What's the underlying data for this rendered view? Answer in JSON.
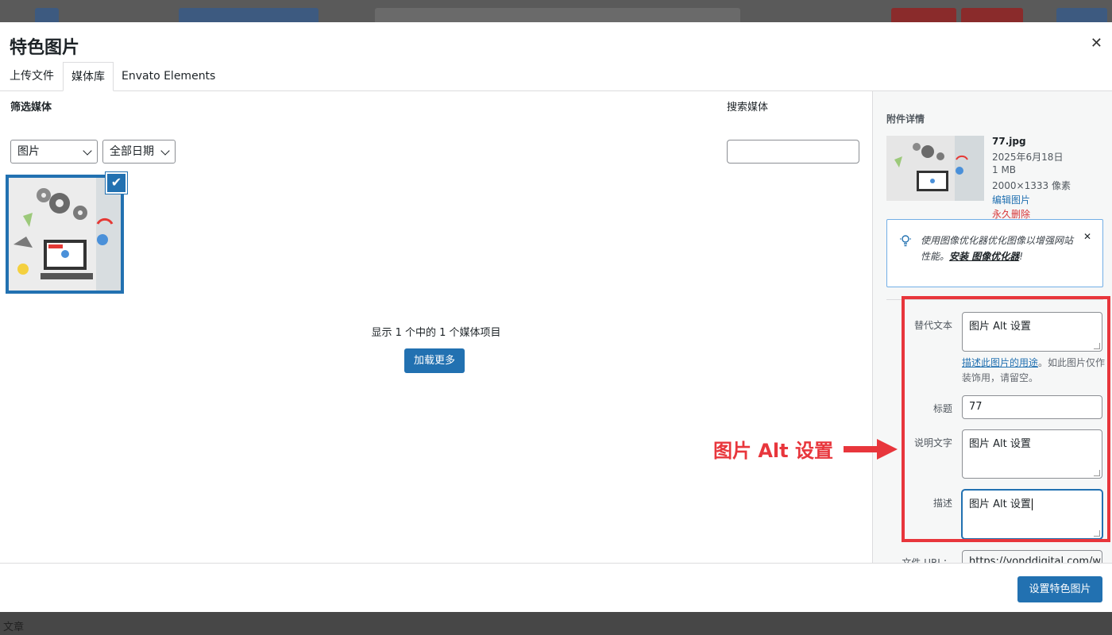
{
  "modal": {
    "title": "特色图片",
    "close_glyph": "✕"
  },
  "tabs": [
    {
      "label": "上传文件"
    },
    {
      "label": "媒体库",
      "active": true
    },
    {
      "label": "Envato Elements"
    }
  ],
  "library": {
    "filter_label": "筛选媒体",
    "type_filter": "图片",
    "date_filter": "全部日期",
    "search_label": "搜索媒体",
    "search_value": "",
    "count_text": "显示 1 个中的 1 个媒体项目",
    "load_more": "加载更多",
    "check_glyph": "✔"
  },
  "details": {
    "heading": "附件详情",
    "filename": "77.jpg",
    "date": "2025年6月18日",
    "size": "1 MB",
    "dimensions": "2000×1333 像素",
    "edit_link": "编辑图片",
    "delete_link": "永久删除",
    "notice": {
      "text": "使用图像优化器优化图像以增强网站性能。",
      "link": "安装 图像优化器",
      "suffix": "!",
      "close": "✕"
    },
    "alt_label": "替代文本",
    "alt_value": "图片 Alt 设置",
    "alt_help_link": "描述此图片的用途",
    "alt_help_rest": "。如此图片仅作装饰用，请留空。",
    "title_label": "标题",
    "title_value": "77",
    "caption_label": "说明文字",
    "caption_value": "图片 Alt 设置",
    "desc_label": "描述",
    "desc_value": "图片 Alt 设置",
    "url_label": "文件 URL：",
    "url_value": "https://yonddigital.com/wp"
  },
  "annotation": {
    "text": "图片 Alt 设置",
    "color": "#e8363c"
  },
  "footer": {
    "primary_button": "设置特色图片"
  },
  "bg_bottom_text": "文章",
  "colors": {
    "accent": "#2271b1",
    "danger": "#d63638",
    "annotation": "#e8363c"
  }
}
